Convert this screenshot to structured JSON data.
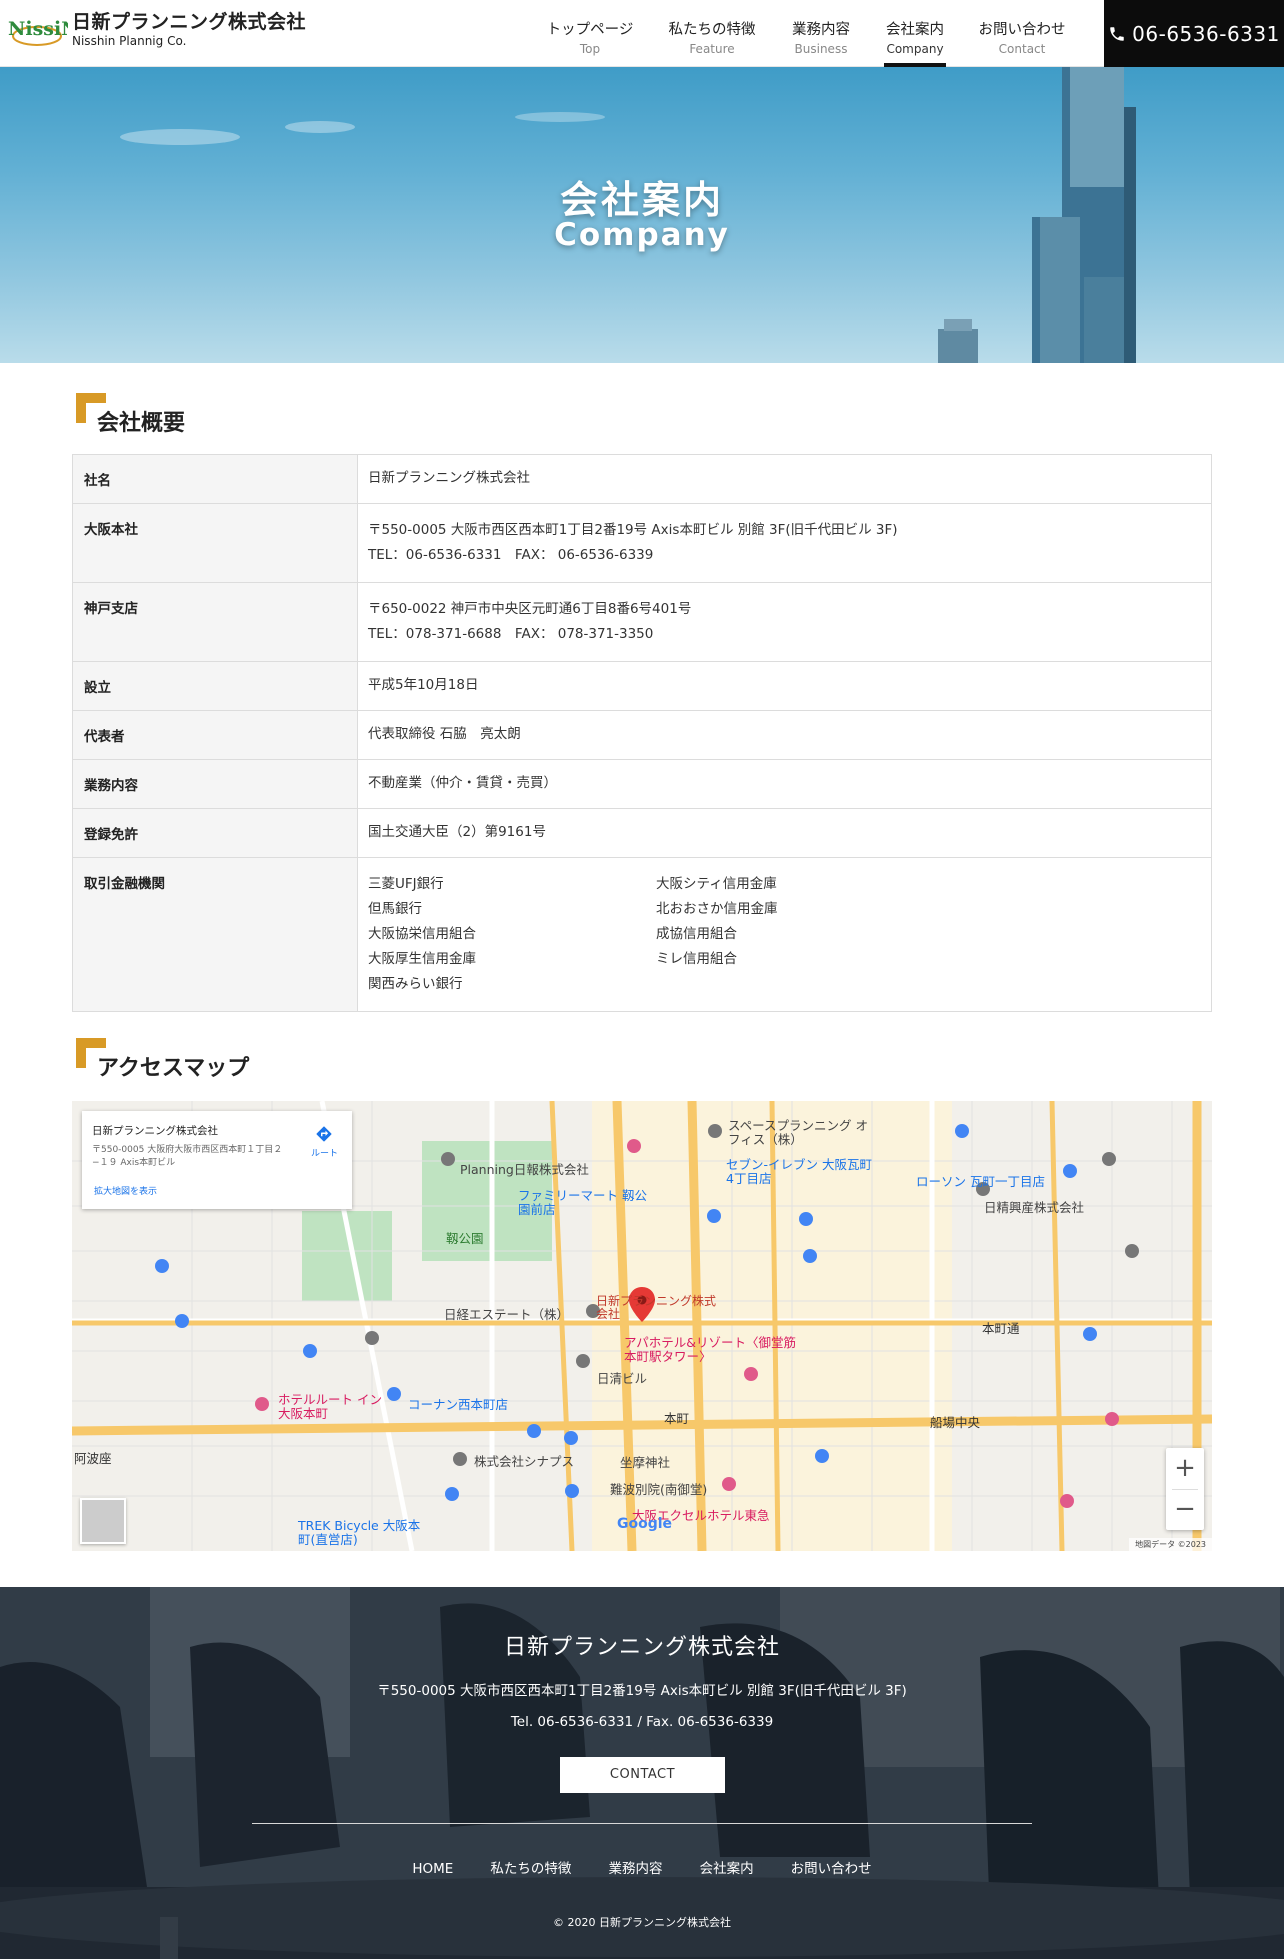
{
  "header": {
    "company_ja": "日新プランニング株式会社",
    "company_en": "Nisshin Plannig Co.",
    "logo_text": "NissiN",
    "nav": [
      {
        "ja": "トップページ",
        "en": "Top"
      },
      {
        "ja": "私たちの特徴",
        "en": "Feature"
      },
      {
        "ja": "業務内容",
        "en": "Business"
      },
      {
        "ja": "会社案内",
        "en": "Company",
        "active": true
      },
      {
        "ja": "お問い合わせ",
        "en": "Contact"
      }
    ],
    "phone": "06-6536-6331"
  },
  "hero": {
    "title_ja": "会社案内",
    "title_en": "Company"
  },
  "overview": {
    "heading": "会社概要",
    "rows": {
      "name": {
        "label": "社名",
        "value": "日新プランニング株式会社"
      },
      "osaka": {
        "label": "大阪本社",
        "line1": "〒550-0005 大阪市西区西本町1丁目2番19号 Axis本町ビル 別館 3F(旧千代田ビル 3F)",
        "line2": "TEL：06-6536-6331　FAX：  06-6536-6339"
      },
      "kobe": {
        "label": "神戸支店",
        "line1": "〒650-0022 神戸市中央区元町通6丁目8番6号401号",
        "line2": "TEL：078-371-6688　FAX：  078-371-3350"
      },
      "founded": {
        "label": "設立",
        "value": "平成5年10月18日"
      },
      "representative": {
        "label": "代表者",
        "value": "代表取締役 石脇　亮太朗"
      },
      "business": {
        "label": "業務内容",
        "value": "不動産業（仲介・賃貸・売買）"
      },
      "license": {
        "label": "登録免許",
        "value": "国土交通大臣（2）第9161号"
      },
      "banks": {
        "label": "取引金融機関",
        "items": [
          "三菱UFJ銀行",
          "大阪シティ信用金庫",
          "但馬銀行",
          "北おおさか信用金庫",
          "大阪協栄信用組合",
          "成協信用組合",
          "大阪厚生信用金庫",
          "ミレ信用組合",
          "関西みらい銀行"
        ]
      }
    }
  },
  "access": {
    "heading": "アクセスマップ",
    "map": {
      "marker_label": "日新プランニング株式会社",
      "card_title": "日新プランニング株式会社",
      "card_addr": "〒550-0005 大阪府大阪市西区西本町１丁目２−１９ Axis本町ビル",
      "card_link": "拡大地図を表示",
      "card_dir": "ルート",
      "labels": [
        "本町通",
        "船場中央",
        "本町",
        "阿波座",
        "靱公園",
        "日経エステート（株）",
        "日清ビル",
        "アパホテル&リゾート〈御堂筋本町駅タワー〉",
        "坐摩神社",
        "難波別院(南御堂)",
        "大阪エクセルホテル東急",
        "セブン-イレブン 大阪瓦町4丁目店",
        "ローソン 瓦町一丁目店",
        "日精興産株式会社",
        "ホテルルート イン大阪本町",
        "コーナン西本町店",
        "株式会社シナプス",
        "TREK Bicycle 大阪本町(直営店)",
        "Planning日報株式会社",
        "ファミリーマート 靱公園前店",
        "スペースプランニング オフィス（株）"
      ],
      "google": "Google",
      "attribution": "地図データ ©2023",
      "zoom_in": "+",
      "zoom_out": "−"
    }
  },
  "footer": {
    "company": "日新プランニング株式会社",
    "address": "〒550-0005 大阪市西区西本町1丁目2番19号 Axis本町ビル 別館 3F(旧千代田ビル 3F)",
    "tel": "Tel. 06-6536-6331 / Fax. 06-6536-6339",
    "contact_button": "CONTACT",
    "nav": [
      "HOME",
      "私たちの特徴",
      "業務内容",
      "会社案内",
      "お問い合わせ"
    ],
    "copyright": "©  2020 日新プランニング株式会社"
  }
}
